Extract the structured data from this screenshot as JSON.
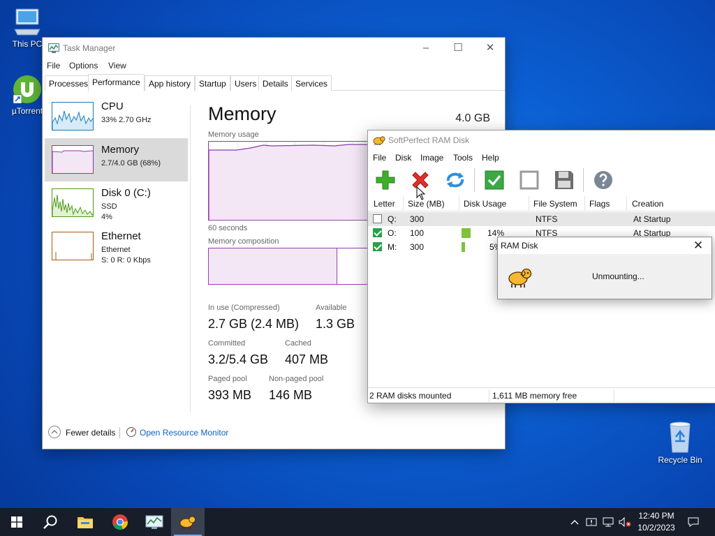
{
  "desktop": {
    "icons": [
      {
        "label": "This PC"
      },
      {
        "label": "µTorrent"
      },
      {
        "label": "Recycle Bin"
      }
    ]
  },
  "task_manager": {
    "title": "Task Manager",
    "menu": [
      "File",
      "Options",
      "View"
    ],
    "tabs": [
      "Processes",
      "Performance",
      "App history",
      "Startup",
      "Users",
      "Details",
      "Services"
    ],
    "active_tab": "Performance",
    "perf_items": [
      {
        "name": "CPU",
        "sub1": "33% 2.70 GHz",
        "sub2": "",
        "color": "#1a7ab8"
      },
      {
        "name": "Memory",
        "sub1": "2.7/4.0 GB (68%)",
        "sub2": "",
        "color": "#8b3aa6"
      },
      {
        "name": "Disk 0 (C:)",
        "sub1": "SSD",
        "sub2": "4%",
        "color": "#4e9a1b"
      },
      {
        "name": "Ethernet",
        "sub1": "Ethernet",
        "sub2": "S: 0 R: 0 Kbps",
        "color": "#a75b12"
      }
    ],
    "memory": {
      "title": "Memory",
      "total": "4.0 GB",
      "usage_label": "Memory usage",
      "time_label": "60 seconds",
      "composition_label": "Memory composition",
      "stats": [
        {
          "label": "In use (Compressed)",
          "value": "2.7 GB (2.4 MB)"
        },
        {
          "label": "Available",
          "value": "1.3 GB"
        },
        {
          "label": "Committed",
          "value": "3.2/5.4 GB"
        },
        {
          "label": "Cached",
          "value": "407 MB"
        },
        {
          "label": "Paged pool",
          "value": "393 MB"
        },
        {
          "label": "Non-paged pool",
          "value": "146 MB"
        }
      ]
    },
    "footer": {
      "fewer_details": "Fewer details",
      "open_resource_monitor": "Open Resource Monitor"
    }
  },
  "ram_disk": {
    "title": "SoftPerfect RAM Disk",
    "menu": [
      "File",
      "Disk",
      "Image",
      "Tools",
      "Help"
    ],
    "toolbar": [
      "add-icon",
      "remove-icon",
      "refresh-icon",
      "mount-icon",
      "unmount-icon",
      "save-image-icon",
      "help-icon"
    ],
    "columns": [
      "Letter",
      "Size (MB)",
      "Disk Usage",
      "File System",
      "Flags",
      "Creation"
    ],
    "rows": [
      {
        "checked": false,
        "letter": "Q:",
        "size": "300",
        "usage_text": "",
        "usage_fraction": 0,
        "fs": "NTFS",
        "flags": "",
        "creation": "At Startup"
      },
      {
        "checked": true,
        "letter": "O:",
        "size": "100",
        "usage_text": "14%",
        "usage_fraction": 0.14,
        "fs": "NTFS",
        "flags": "",
        "creation": "At Startup"
      },
      {
        "checked": true,
        "letter": "M:",
        "size": "300",
        "usage_text": "5%",
        "usage_fraction": 0.05,
        "fs": "",
        "flags": "",
        "creation": ""
      }
    ],
    "status": {
      "mounted": "2 RAM disks mounted",
      "free": "1,611 MB memory free"
    }
  },
  "dialog": {
    "title": "RAM Disk",
    "message": "Unmounting..."
  },
  "taskbar": {
    "clock_time": "12:40 PM",
    "clock_date": "10/2/2023"
  },
  "colors": {
    "accent_purple": "#8b3aa6",
    "ok_green": "#2aa047",
    "taskbar": "#171d29"
  }
}
